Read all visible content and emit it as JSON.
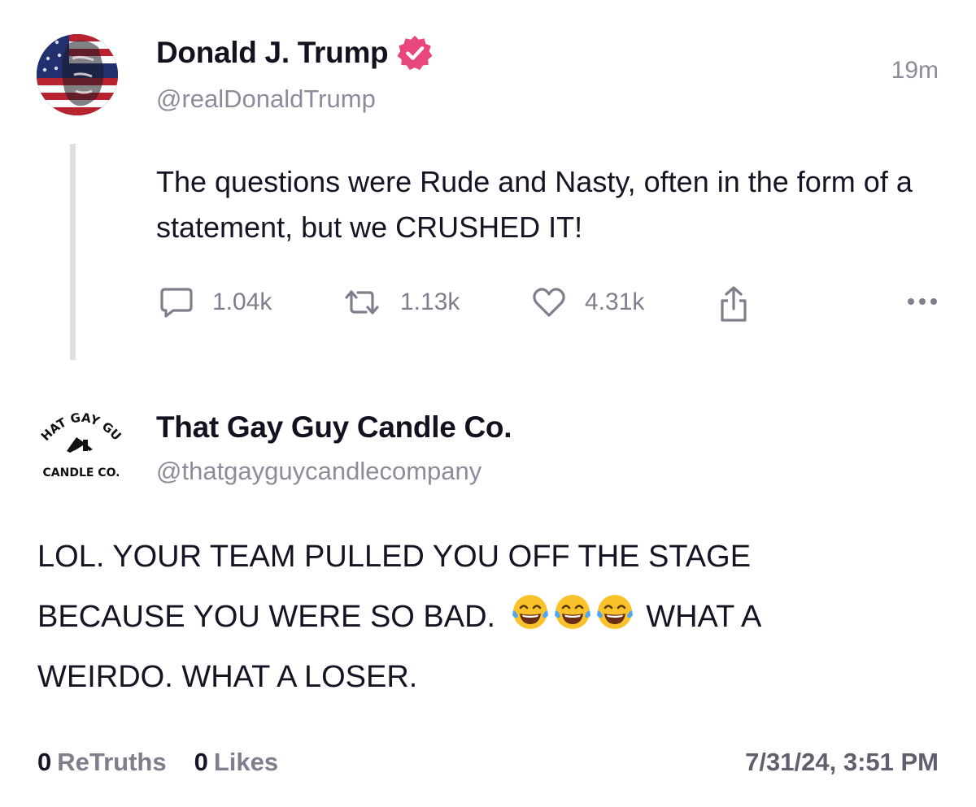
{
  "post": {
    "author": {
      "display_name": "Donald J. Trump",
      "handle": "@realDonaldTrump",
      "verified": true,
      "avatar_icon": "flag-portrait-avatar"
    },
    "relative_time": "19m",
    "text": "The questions were Rude and Nasty, often in the form of a statement, but we CRUSHED IT!",
    "actions": {
      "replies": "1.04k",
      "retruths": "1.13k",
      "likes": "4.31k",
      "reply_icon": "comment-icon",
      "retruth_icon": "repost-icon",
      "like_icon": "heart-icon",
      "share_icon": "share-icon",
      "more_icon": "more-dots-icon"
    }
  },
  "reply": {
    "author": {
      "display_name": "That Gay Guy Candle Co.",
      "handle": "@thatgayguycandlecompany",
      "logo_text_top": "THAT GAY GUY",
      "logo_text_bottom": "CANDLE CO."
    },
    "text_before_emoji": "LOL. YOUR TEAM PULLED YOU OFF THE STAGE BECAUSE YOU WERE SO BAD.",
    "emoji": [
      "😂",
      "😂",
      "😂"
    ],
    "text_after_emoji": "WHAT A WEIRDO. WHAT A LOSER.",
    "stats": {
      "retruths_count": "0",
      "retruths_label": "ReTruths",
      "likes_count": "0",
      "likes_label": "Likes"
    },
    "timestamp": "7/31/24, 3:51 PM"
  },
  "colors": {
    "verified_badge": "#e8467c",
    "text_primary": "#11111f",
    "text_secondary": "#8c8c9a",
    "thread_line": "#dfdfe3"
  }
}
